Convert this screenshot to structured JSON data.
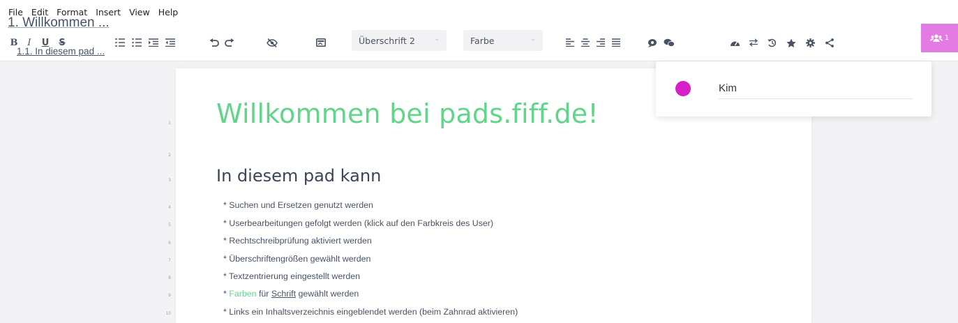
{
  "menu": [
    "File",
    "Edit",
    "Format",
    "Insert",
    "View",
    "Help"
  ],
  "toolbar": {
    "bold": "B",
    "italic": "I",
    "underline": "U",
    "strike": "S",
    "heading_select": "Überschrift 2",
    "color_select": "Farbe",
    "select_caret": "⌄",
    "users_count": "1"
  },
  "toc": {
    "h1": "1. Willkommen ...",
    "h2": "1.1. In diesem pad ..."
  },
  "document": {
    "title": "Willkommen bei pads.fiff.de!",
    "heading2": "In diesem pad kann",
    "line_numbers": [
      "1",
      "2",
      "3",
      "4",
      "5",
      "6",
      "7",
      "8",
      "9",
      "10"
    ],
    "lines": [
      "* Suchen und Ersetzen genutzt werden",
      "* Userbearbeitungen gefolgt werden (klick auf den Farbkreis des User)",
      "* Rechtschreibprüfung aktiviert werden",
      "* Überschriftengrößen gewählt werden",
      "* Textzentrierung eingestellt werden"
    ],
    "line9": {
      "prefix": "* ",
      "farben": "Farben",
      "fuer": " für ",
      "schrift": "Schrift",
      "suffix": " gewählt werden"
    },
    "line10": "* Links ein Inhaltsverzeichnis eingeblendet werden (beim Zahnrad aktivieren)"
  },
  "users_popover": {
    "name": "Kim",
    "color": "#d61fc7"
  },
  "colors": {
    "accent_green": "#61d68a",
    "users_button": "#e47ae3",
    "text": "#485365"
  }
}
